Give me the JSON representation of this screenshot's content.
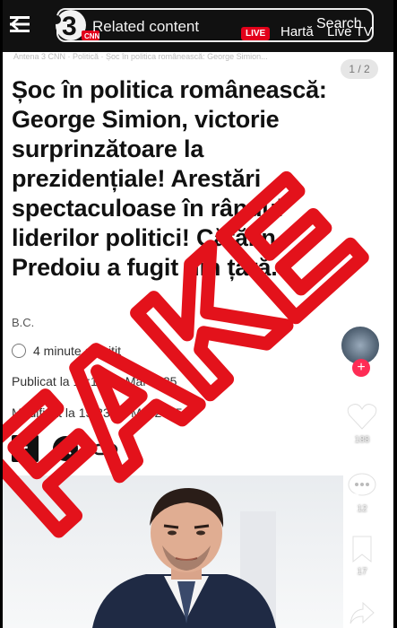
{
  "header": {
    "related_label": "Related content",
    "live_label": "LIVE",
    "harta_label": "Hartă",
    "search_label": "Search",
    "livetv_label": "Live TV"
  },
  "breadcrumb": "Antena 3 CNN · Politică · Șoc în politica românească: George Simion...",
  "pager": "1 / 2",
  "article": {
    "headline": "Șoc în politica românească: George Simion, victorie surprinzătoare la prezidențiale! Arestări spectaculoase în rândul liderilor politici! Cătălin Predoiu a fugit din țară.",
    "author": "B.C.",
    "read_time": "4 minute de citit",
    "published": "Publicat la 15:14 20 Mai 2025",
    "modified": "Modificat la 15:23 20 Mai 2025"
  },
  "side_actions": {
    "likes": "188",
    "comments": "12",
    "saves": "17"
  },
  "overlay": {
    "stamp_text": "FAKE",
    "stamp_color": "#e3121b"
  },
  "colors": {
    "brand_red": "#e2001a",
    "topbar_bg": "#111111"
  }
}
